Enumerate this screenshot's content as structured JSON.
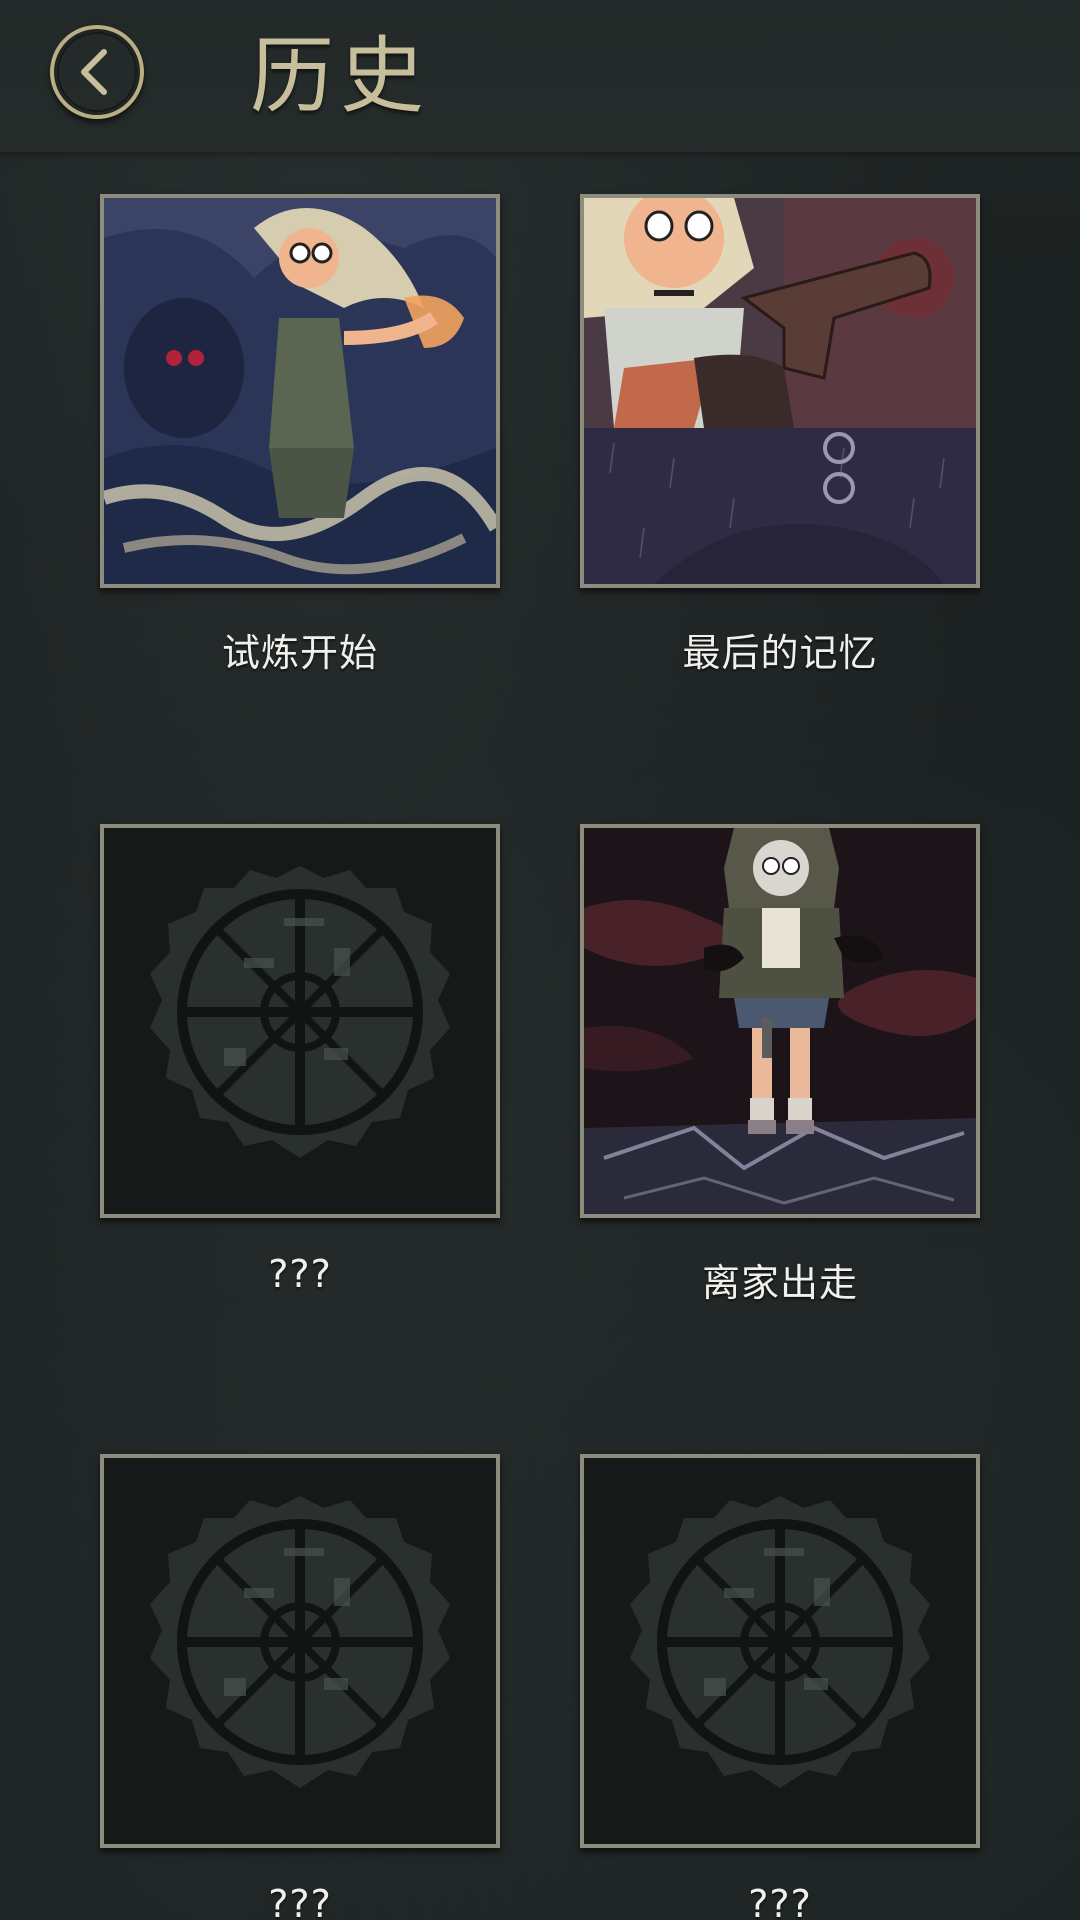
{
  "header": {
    "title": "历史",
    "back_icon": "chevron-left-icon"
  },
  "gallery": {
    "items": [
      {
        "title": "试炼开始",
        "locked": false,
        "art": "girl-and-masked-figure"
      },
      {
        "title": "最后的记忆",
        "locked": false,
        "art": "girl-with-pistol"
      },
      {
        "title": "???",
        "locked": true,
        "art": "locked-seal"
      },
      {
        "title": "离家出走",
        "locked": false,
        "art": "hooded-girl-standing"
      },
      {
        "title": "???",
        "locked": true,
        "art": "locked-seal"
      },
      {
        "title": "???",
        "locked": true,
        "art": "locked-seal"
      }
    ]
  },
  "colors": {
    "gold_accent": "#c7bf9b",
    "frame": "#8d8c7f",
    "background": "#1b2020"
  }
}
